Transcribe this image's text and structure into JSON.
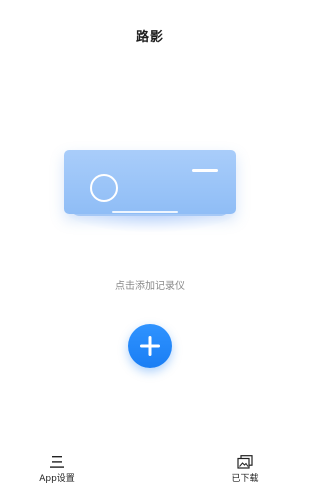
{
  "header": {
    "title": "路影"
  },
  "main": {
    "hint": "点击添加记录仪",
    "add_button_icon": "plus-icon",
    "device_illustration": "dashcam-device-illustration"
  },
  "bottom_nav": {
    "settings": {
      "label": "App设置",
      "icon": "menu-lines-icon"
    },
    "downloaded": {
      "label": "已下载",
      "icon": "gallery-icon"
    }
  },
  "colors": {
    "accent": "#1a7ef4",
    "device": "#9fc6f8",
    "hint_text": "#8a8a8a",
    "title_text": "#1f1f1f"
  }
}
